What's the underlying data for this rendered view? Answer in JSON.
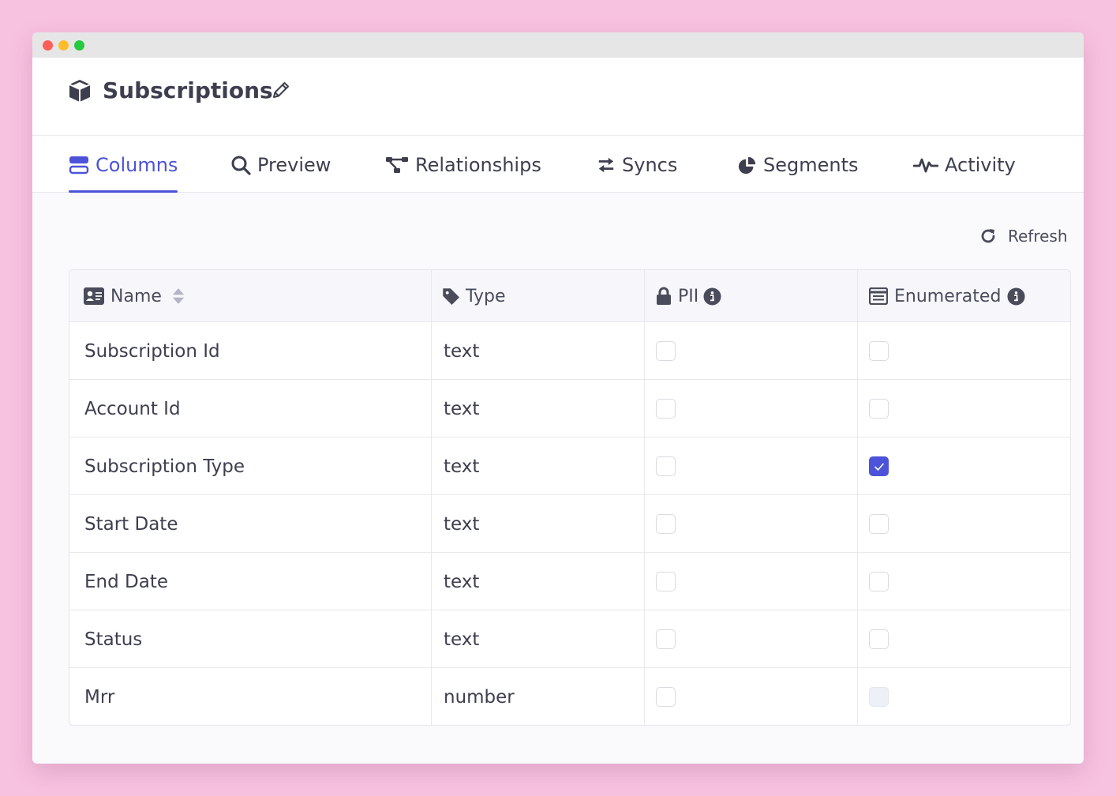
{
  "page": {
    "title": "Subscriptions"
  },
  "tabs": [
    {
      "label": "Columns",
      "icon": "table-columns-icon",
      "active": true
    },
    {
      "label": "Preview",
      "icon": "search-icon",
      "active": false
    },
    {
      "label": "Relationships",
      "icon": "relationships-icon",
      "active": false
    },
    {
      "label": "Syncs",
      "icon": "sync-arrows-icon",
      "active": false
    },
    {
      "label": "Segments",
      "icon": "pie-chart-icon",
      "active": false
    },
    {
      "label": "Activity",
      "icon": "activity-pulse-icon",
      "active": false
    }
  ],
  "toolbar": {
    "refresh_label": "Refresh"
  },
  "table": {
    "headers": {
      "name": "Name",
      "type": "Type",
      "pii": "PII",
      "enumerated": "Enumerated"
    },
    "rows": [
      {
        "name": "Subscription Id",
        "type": "text",
        "pii": false,
        "enumerated": false,
        "enumerated_disabled": false
      },
      {
        "name": "Account Id",
        "type": "text",
        "pii": false,
        "enumerated": false,
        "enumerated_disabled": false
      },
      {
        "name": "Subscription Type",
        "type": "text",
        "pii": false,
        "enumerated": true,
        "enumerated_disabled": false
      },
      {
        "name": "Start Date",
        "type": "text",
        "pii": false,
        "enumerated": false,
        "enumerated_disabled": false
      },
      {
        "name": "End Date",
        "type": "text",
        "pii": false,
        "enumerated": false,
        "enumerated_disabled": false
      },
      {
        "name": "Status",
        "type": "text",
        "pii": false,
        "enumerated": false,
        "enumerated_disabled": false
      },
      {
        "name": "Mrr",
        "type": "number",
        "pii": false,
        "enumerated": false,
        "enumerated_disabled": true
      }
    ]
  },
  "colors": {
    "accent": "#4c53d8",
    "background": "#f7c2e0"
  }
}
